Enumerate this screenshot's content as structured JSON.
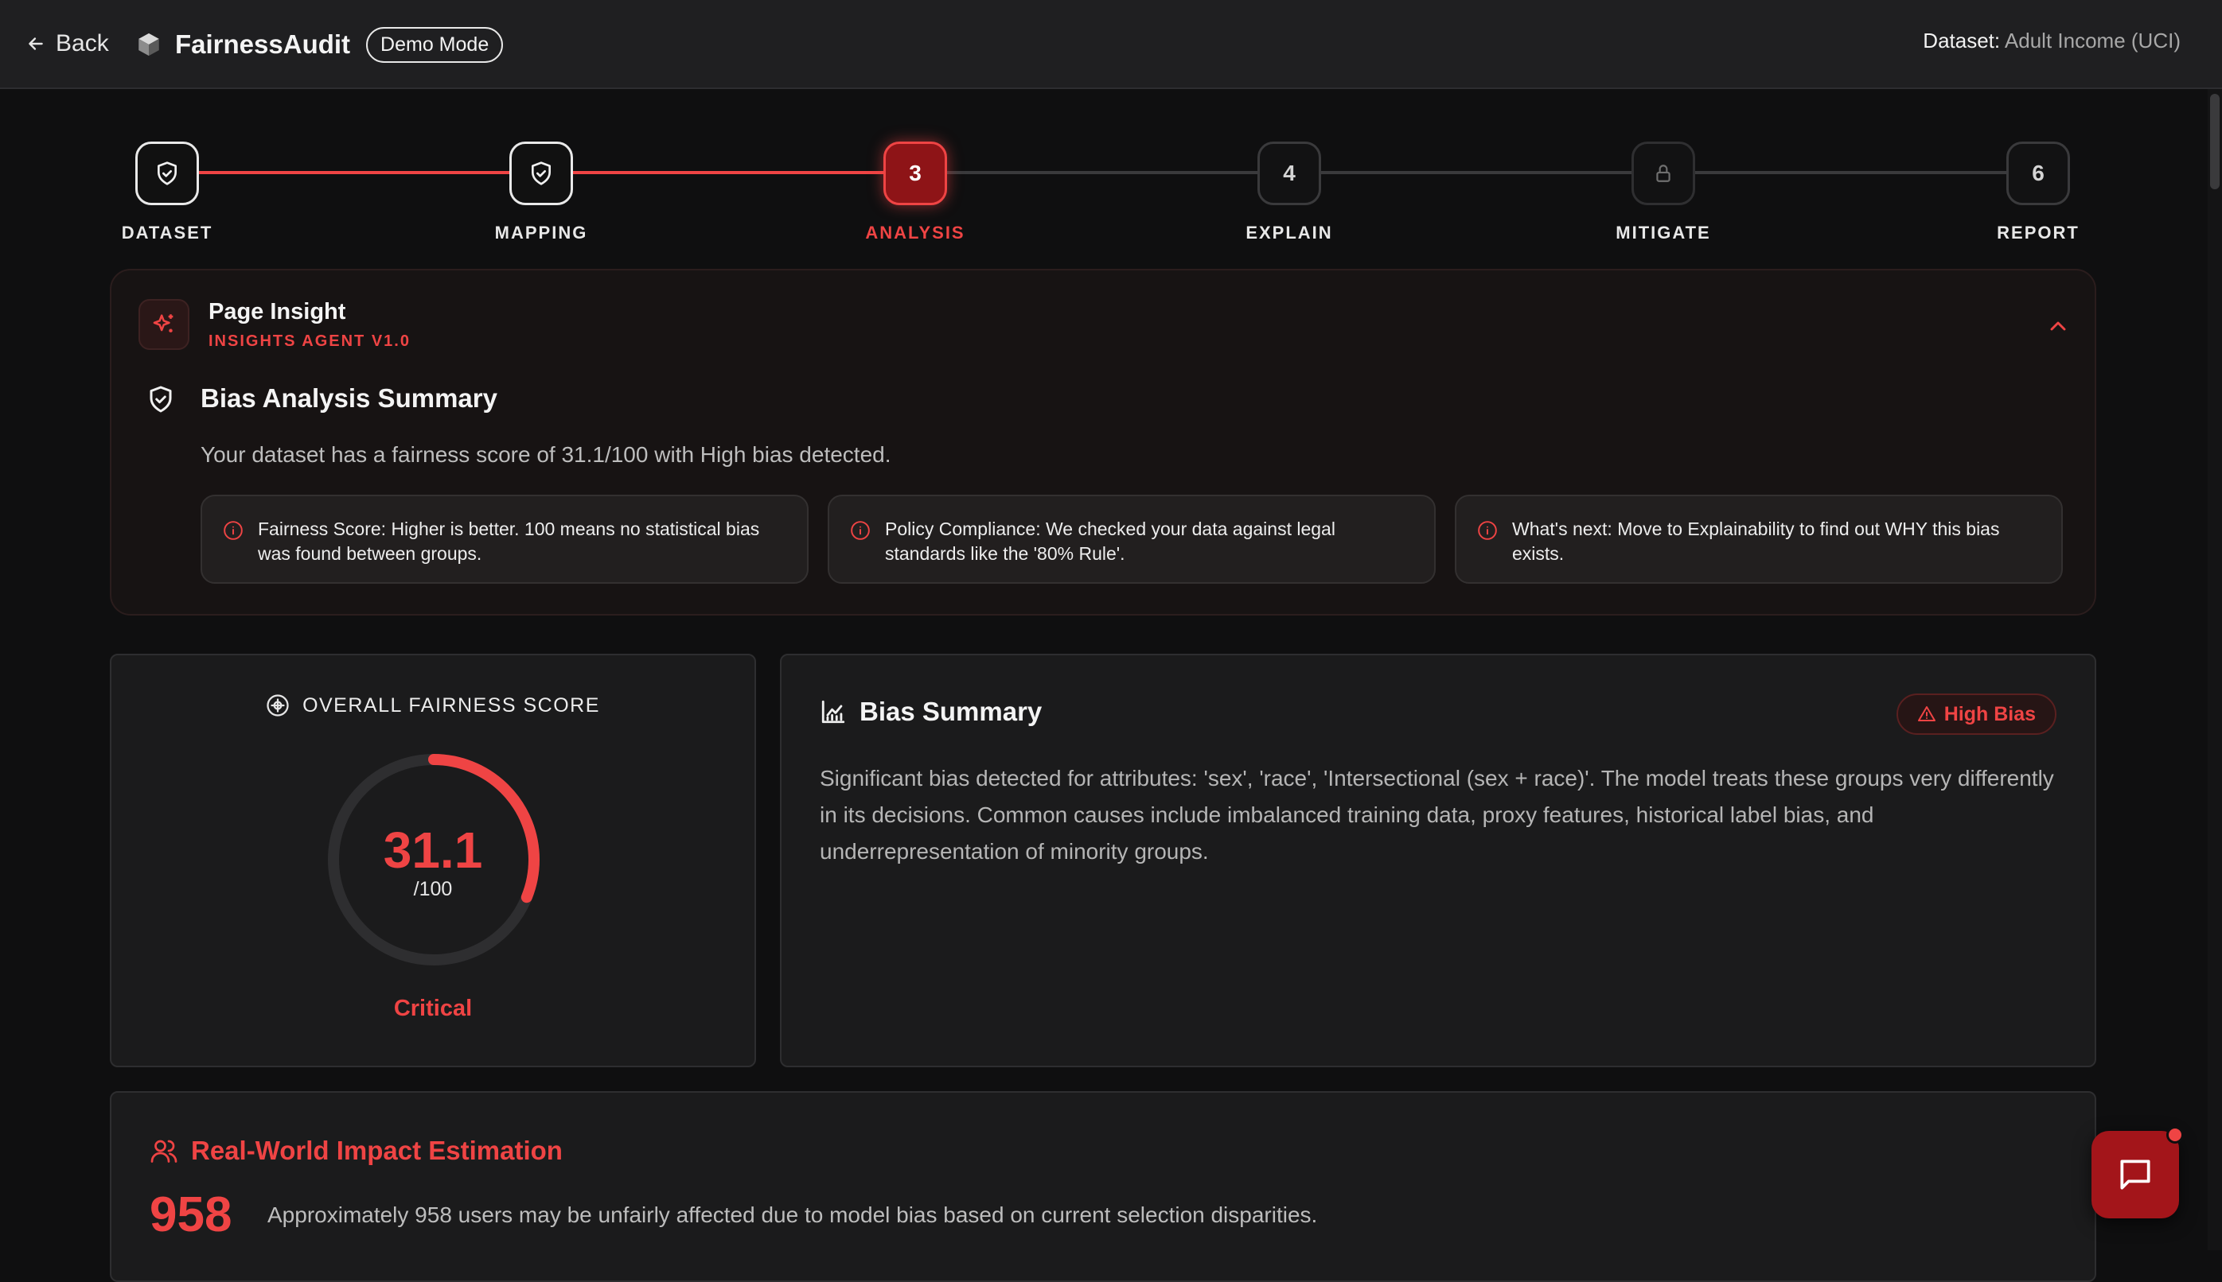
{
  "header": {
    "back_label": "Back",
    "brand": "FairnessAudit",
    "mode_badge": "Demo Mode",
    "dataset_label": "Dataset:",
    "dataset_value": "Adult Income (UCI)"
  },
  "stepper": {
    "steps": [
      {
        "label": "DATASET",
        "number": "",
        "state": "done",
        "icon": "shield-check-icon"
      },
      {
        "label": "MAPPING",
        "number": "",
        "state": "done",
        "icon": "shield-check-icon"
      },
      {
        "label": "ANALYSIS",
        "number": "3",
        "state": "active"
      },
      {
        "label": "EXPLAIN",
        "number": "4",
        "state": "pending"
      },
      {
        "label": "MITIGATE",
        "number": "",
        "state": "locked",
        "icon": "lock-icon"
      },
      {
        "label": "REPORT",
        "number": "6",
        "state": "pending"
      }
    ]
  },
  "insight": {
    "title": "Page Insight",
    "subtitle": "INSIGHTS AGENT V1.0",
    "summary_title": "Bias Analysis Summary",
    "summary_text": "Your dataset has a fairness score of 31.1/100 with High bias detected.",
    "tips": [
      "Fairness Score: Higher is better. 100 means no statistical bias was found between groups.",
      "Policy Compliance: We checked your data against legal standards like the '80% Rule'.",
      "What's next: Move to Explainability to find out WHY this bias exists."
    ]
  },
  "score": {
    "heading": "OVERALL FAIRNESS SCORE",
    "value": "31.1",
    "max": "/100",
    "fraction": 0.311,
    "status": "Critical"
  },
  "bias_summary": {
    "title": "Bias Summary",
    "badge": "High Bias",
    "text": "Significant bias detected for attributes: 'sex', 'race', 'Intersectional (sex + race)'. The model treats these groups very differently in its decisions. Common causes include imbalanced training data, proxy features, historical label bias, and underrepresentation of minority groups."
  },
  "impact": {
    "title": "Real-World Impact Estimation",
    "number": "958",
    "text": "Approximately 958 users may be unfairly affected due to model bias based on current selection disparities."
  },
  "colors": {
    "accent": "#ef4444",
    "background": "#0f0f10",
    "card": "#1b1b1c"
  }
}
